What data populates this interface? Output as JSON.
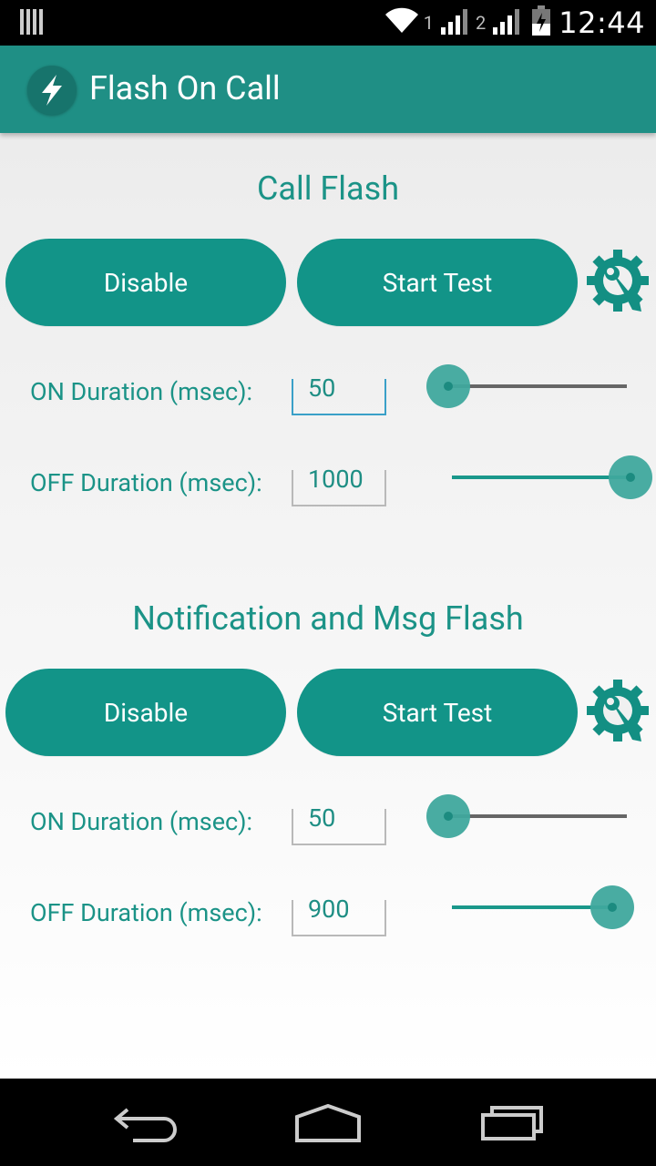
{
  "status_bar": {
    "sim1": "1",
    "sim2": "2",
    "time": "12:44",
    "icons": [
      "notification-bars-icon",
      "wifi-icon",
      "signal-icon",
      "signal-icon",
      "battery-charging-icon"
    ]
  },
  "app_bar": {
    "title": "Flash On Call",
    "logo_icon": "lightning-bolt-icon",
    "accent": "#1f8f85"
  },
  "call_flash": {
    "title": "Call Flash",
    "disable_label": "Disable",
    "start_test_label": "Start Test",
    "on_label": "ON Duration (msec):",
    "on_value": "50",
    "on_slider_fraction": 0.0,
    "off_label": "OFF Duration (msec):",
    "off_value": "1000",
    "off_slider_fraction": 1.0
  },
  "notification_flash": {
    "title": "Notification and Msg Flash",
    "disable_label": "Disable",
    "start_test_label": "Start Test",
    "on_label": "ON Duration (msec):",
    "on_value": "50",
    "on_slider_fraction": 0.0,
    "off_label": "OFF Duration (msec):",
    "off_value": "900",
    "off_slider_fraction": 0.9
  },
  "nav_bar": {
    "icons": [
      "back-icon",
      "home-icon",
      "recents-icon"
    ]
  }
}
